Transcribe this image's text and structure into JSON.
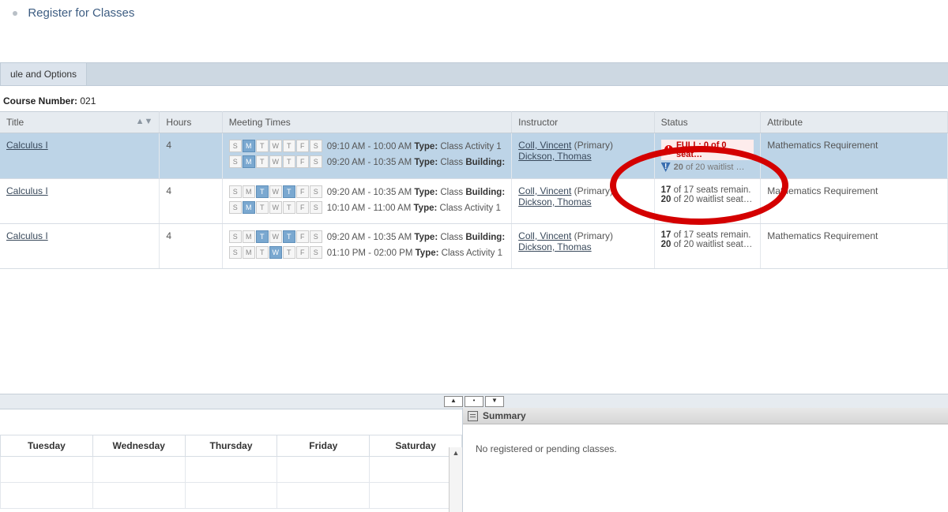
{
  "page_title": "Register for Classes",
  "tabs": [
    "ule and Options"
  ],
  "course_number_label": "Course Number:",
  "course_number_value": "021",
  "columns": {
    "title": "Title",
    "hours": "Hours",
    "meeting": "Meeting Times",
    "instructor": "Instructor",
    "status": "Status",
    "attribute": "Attribute"
  },
  "day_labels": [
    "S",
    "M",
    "T",
    "W",
    "T",
    "F",
    "S"
  ],
  "rows": [
    {
      "title": "Calculus I",
      "hours": "4",
      "meetings": [
        {
          "days_on": [
            1
          ],
          "time": "09:10 AM - 10:00 AM",
          "type_label": "Type:",
          "type_val": "Class Activity 1",
          "bld_label": ""
        },
        {
          "days_on": [
            1
          ],
          "time": "09:20 AM - 10:35 AM",
          "type_label": "Type:",
          "type_val": "Class",
          "bld_label": "Building:"
        }
      ],
      "instructors": [
        {
          "name": "Coll, Vincent",
          "suffix": " (Primary)"
        },
        {
          "name": "Dickson, Thomas",
          "suffix": ""
        }
      ],
      "status": {
        "full_badge": "FULL: 0 of 0 seat…",
        "wait": "20 of 20 waitlist …"
      },
      "attribute": "Mathematics Requirement",
      "selected": true
    },
    {
      "title": "Calculus I",
      "hours": "4",
      "meetings": [
        {
          "days_on": [
            2,
            4
          ],
          "time": "09:20 AM - 10:35 AM",
          "type_label": "Type:",
          "type_val": "Class",
          "bld_label": "Building:"
        },
        {
          "days_on": [
            1
          ],
          "time": "10:10 AM - 11:00 AM",
          "type_label": "Type:",
          "type_val": "Class Activity 1",
          "bld_label": ""
        }
      ],
      "instructors": [
        {
          "name": "Coll, Vincent",
          "suffix": " (Primary)"
        },
        {
          "name": "Dickson, Thomas",
          "suffix": ""
        }
      ],
      "status": {
        "seats_b": "17",
        "seats_t": " of 17 seats remain.",
        "wait_b": "20",
        "wait_t": " of 20 waitlist seat…"
      },
      "attribute": "Mathematics Requirement",
      "selected": false
    },
    {
      "title": "Calculus I",
      "hours": "4",
      "meetings": [
        {
          "days_on": [
            2,
            4
          ],
          "time": "09:20 AM - 10:35 AM",
          "type_label": "Type:",
          "type_val": "Class",
          "bld_label": "Building:"
        },
        {
          "days_on": [
            3
          ],
          "time": "01:10 PM - 02:00 PM",
          "type_label": "Type:",
          "type_val": "Class Activity 1",
          "bld_label": ""
        }
      ],
      "instructors": [
        {
          "name": "Coll, Vincent",
          "suffix": " (Primary)"
        },
        {
          "name": "Dickson, Thomas",
          "suffix": ""
        }
      ],
      "status": {
        "seats_b": "17",
        "seats_t": " of 17 seats remain.",
        "wait_b": "20",
        "wait_t": " of 20 waitlist seat…"
      },
      "attribute": "Mathematics Requirement",
      "selected": false
    }
  ],
  "schedule_days": [
    "Tuesday",
    "Wednesday",
    "Thursday",
    "Friday",
    "Saturday"
  ],
  "summary_title": "Summary",
  "summary_empty": "No registered or pending classes."
}
